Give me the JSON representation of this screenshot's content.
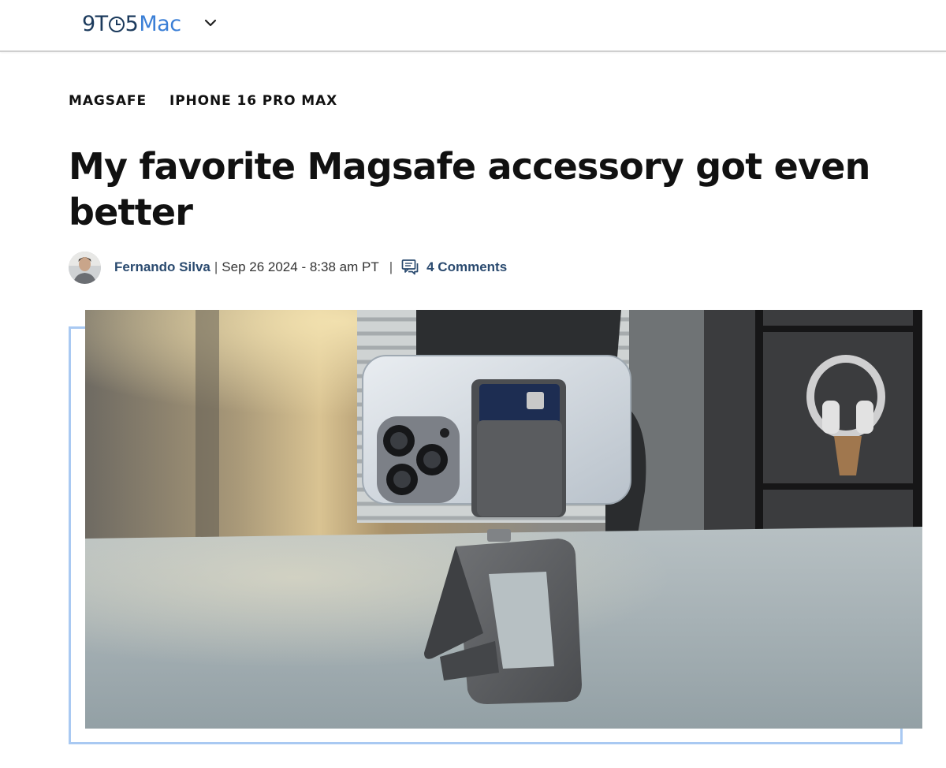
{
  "header": {
    "logo": {
      "part1": "9T",
      "part2": "5",
      "part3": "Mac"
    },
    "menu_icon": "chevron-down-icon"
  },
  "article": {
    "tags": [
      "MAGSAFE",
      "IPHONE 16 PRO MAX"
    ],
    "title": "My favorite Magsafe accessory got even better",
    "author": "Fernando Silva",
    "date": "Sep 26 2024 - 8:38 am PT",
    "comments": "4 Comments",
    "comment_icon": "comment-icon",
    "separator": "|"
  },
  "colors": {
    "brand_dark": "#1b3a5c",
    "brand_accent": "#3b7fd6",
    "link": "#2a4a6f",
    "hero_frame": "#a9c9f2"
  }
}
